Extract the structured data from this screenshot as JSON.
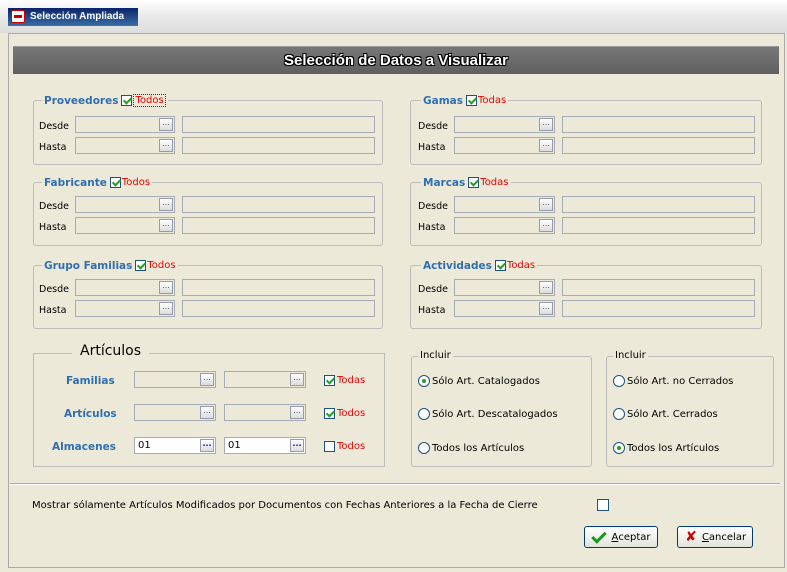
{
  "window": {
    "title": "Selección Ampliada"
  },
  "banner": {
    "title": "Selección de Datos a Visualizar"
  },
  "labels": {
    "desde": "Desde",
    "hasta": "Hasta",
    "ellipsis": "..."
  },
  "groups": {
    "proveedores": {
      "title": "Proveedores",
      "todo": "Todos",
      "checked": true
    },
    "gamas": {
      "title": "Gamas",
      "todo": "Todas",
      "checked": true
    },
    "fabricante": {
      "title": "Fabricante",
      "todo": "Todos",
      "checked": true
    },
    "marcas": {
      "title": "Marcas",
      "todo": "Todas",
      "checked": true
    },
    "grupo_familias": {
      "title": "Grupo Familias",
      "todo": "Todos",
      "checked": true
    },
    "actividades": {
      "title": "Actividades",
      "todo": "Todas",
      "checked": true
    }
  },
  "articulos": {
    "title": "Artículos",
    "rows": [
      {
        "label": "Familias",
        "from": "",
        "to": "",
        "todo": "Todas",
        "checked": true
      },
      {
        "label": "Artículos",
        "from": "",
        "to": "",
        "todo": "Todos",
        "checked": true
      },
      {
        "label": "Almacenes",
        "from": "01",
        "to": "01",
        "todo": "Todos",
        "checked": false
      }
    ]
  },
  "incluir1": {
    "title": "Incluir",
    "options": [
      "Sólo Art. Catalogados",
      "Sólo Art. Descatalogados",
      "Todos los Artículos"
    ],
    "selected": 0
  },
  "incluir2": {
    "title": "Incluir",
    "options": [
      "Sólo Art. no Cerrados",
      "Sólo Art. Cerrados",
      "Todos los Artículos"
    ],
    "selected": 2
  },
  "footer": {
    "modified_label": "Mostrar sólamente Artículos Modificados por Documentos con Fechas Anteriores a la Fecha de Cierre",
    "modified_checked": false,
    "accept": {
      "mnemonic": "A",
      "rest": "ceptar"
    },
    "cancel": {
      "mnemonic": "C",
      "rest": "ancelar"
    }
  }
}
